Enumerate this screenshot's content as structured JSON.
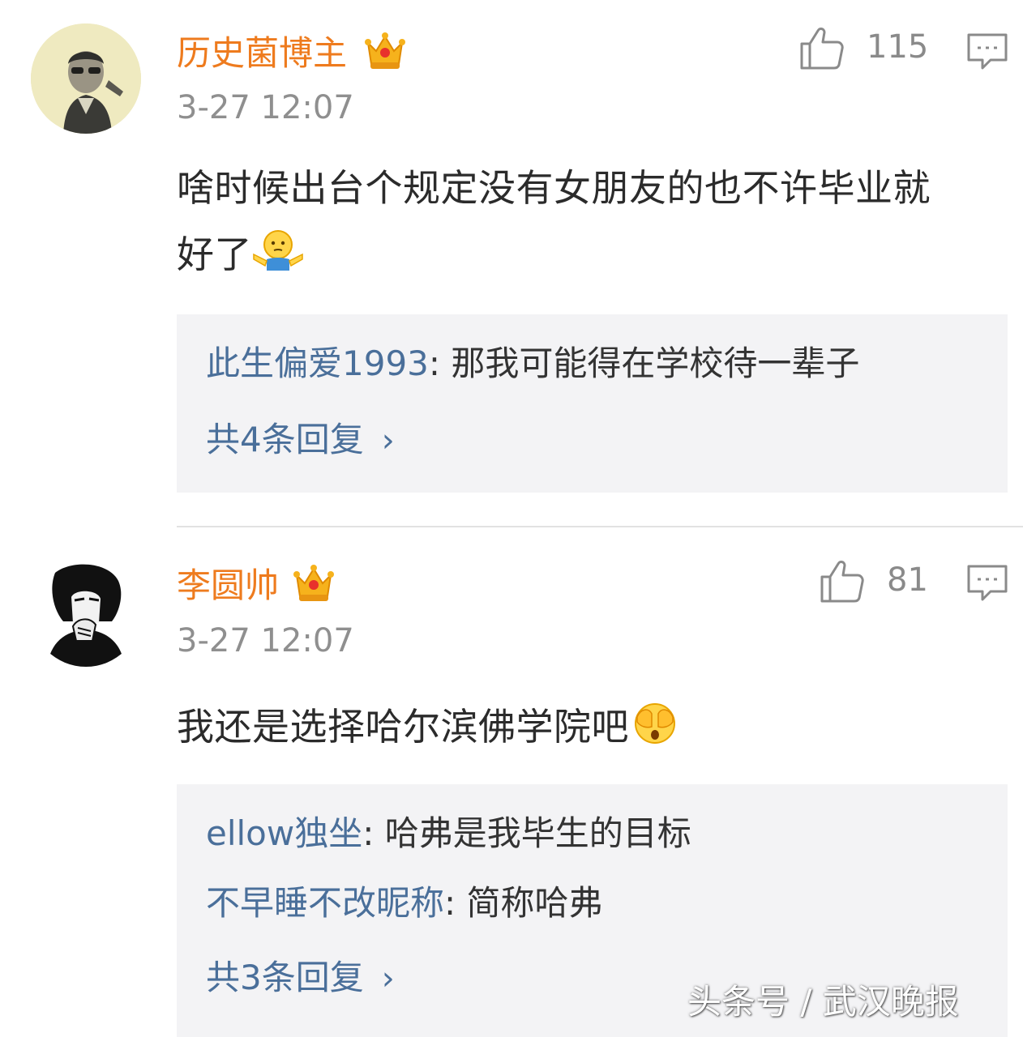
{
  "comments": [
    {
      "username": "历史菌博主",
      "timestamp": "3-27 12:07",
      "like_count": "115",
      "text_line1": "啥时候出台个规定没有女朋友的也不许毕业就",
      "text_line2": "好了",
      "emoji": "shrug-emoji",
      "badge": "crown-icon",
      "replies": [
        {
          "user": "此生偏爱1993",
          "text": ": 那我可能得在学校待一辈子"
        }
      ],
      "reply_total": "共4条回复"
    },
    {
      "username": "李圆帅",
      "timestamp": "3-27 12:07",
      "like_count": "81",
      "text_line1": "我还是选择哈尔滨佛学院吧",
      "emoji": "see-no-evil-emoji",
      "badge": "crown-icon",
      "replies": [
        {
          "user": "ellow独坐",
          "text": ": 哈弗是我毕生的目标"
        },
        {
          "user": "不早睡不改昵称",
          "text": ": 简称哈弗"
        }
      ],
      "reply_total": "共3条回复"
    }
  ],
  "watermark": "头条号 / 武汉晚报",
  "colors": {
    "username": "#ee7b1e",
    "reply_user": "#4a6f9a",
    "timestamp": "#8f8f8f",
    "reply_bg": "#f3f3f5"
  }
}
